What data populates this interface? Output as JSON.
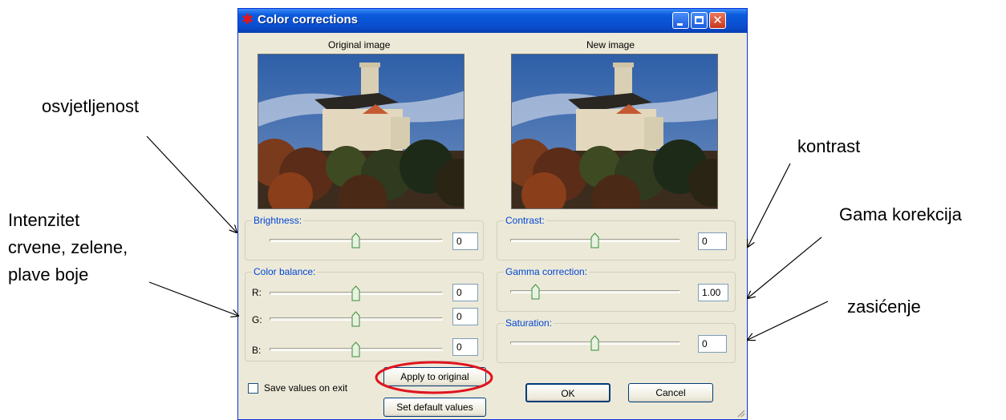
{
  "annotations": {
    "osvjetljenost": "osvjetljenost",
    "intenzitet_line1": "Intenzitet",
    "intenzitet_line2": "crvene, zelene,",
    "intenzitet_line3": "plave boje",
    "kontrast": "kontrast",
    "gama": "Gama korekcija",
    "zasicenje": "zasićenje"
  },
  "window": {
    "title": "Color corrections",
    "icon": "app-icon",
    "title_color": "#0a4fd0"
  },
  "images": {
    "original_caption": "Original image",
    "new_caption": "New image"
  },
  "brightness": {
    "label": "Brightness:",
    "value": "0"
  },
  "color_balance": {
    "label": "Color balance:",
    "channels": [
      {
        "label": "R:",
        "value": "0"
      },
      {
        "label": "G:",
        "value": "0"
      },
      {
        "label": "B:",
        "value": "0"
      }
    ]
  },
  "contrast": {
    "label": "Contrast:",
    "value": "0"
  },
  "gamma": {
    "label": "Gamma correction:",
    "value": "1.00"
  },
  "saturation": {
    "label": "Saturation:",
    "value": "0"
  },
  "save_values_label": "Save values on exit",
  "buttons": {
    "apply": "Apply to original",
    "set_default": "Set default values",
    "ok": "OK",
    "cancel": "Cancel"
  },
  "highlight_color": "#e0141e"
}
